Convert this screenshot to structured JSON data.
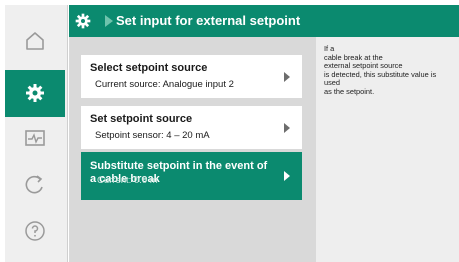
{
  "header": {
    "title": "Set input for external setpoint"
  },
  "rail": {
    "items": [
      {
        "icon": "home-icon"
      },
      {
        "icon": "settings-gear-icon",
        "active": true
      },
      {
        "icon": "diagnostics-monitor-icon"
      },
      {
        "icon": "restore-undo-icon"
      },
      {
        "icon": "help-question-icon"
      }
    ]
  },
  "menu": {
    "items": [
      {
        "title": "Select setpoint source",
        "subtitle": "Current source: Analogue input 2"
      },
      {
        "title": "Set setpoint source",
        "subtitle": "Setpoint sensor: 4 – 20 mA"
      },
      {
        "title": "Substitute setpoint in the event of a cable break",
        "subtitle": "Current: 0.0 m"
      }
    ]
  },
  "help": {
    "lines": [
      "If a",
      "cable break at the",
      "external setpoint source",
      "is detected, this substitute value is",
      "used",
      "as the setpoint."
    ]
  },
  "colors": {
    "accent": "#0b8a6f",
    "panel": "#d9d9d9",
    "rail": "#efefef"
  }
}
